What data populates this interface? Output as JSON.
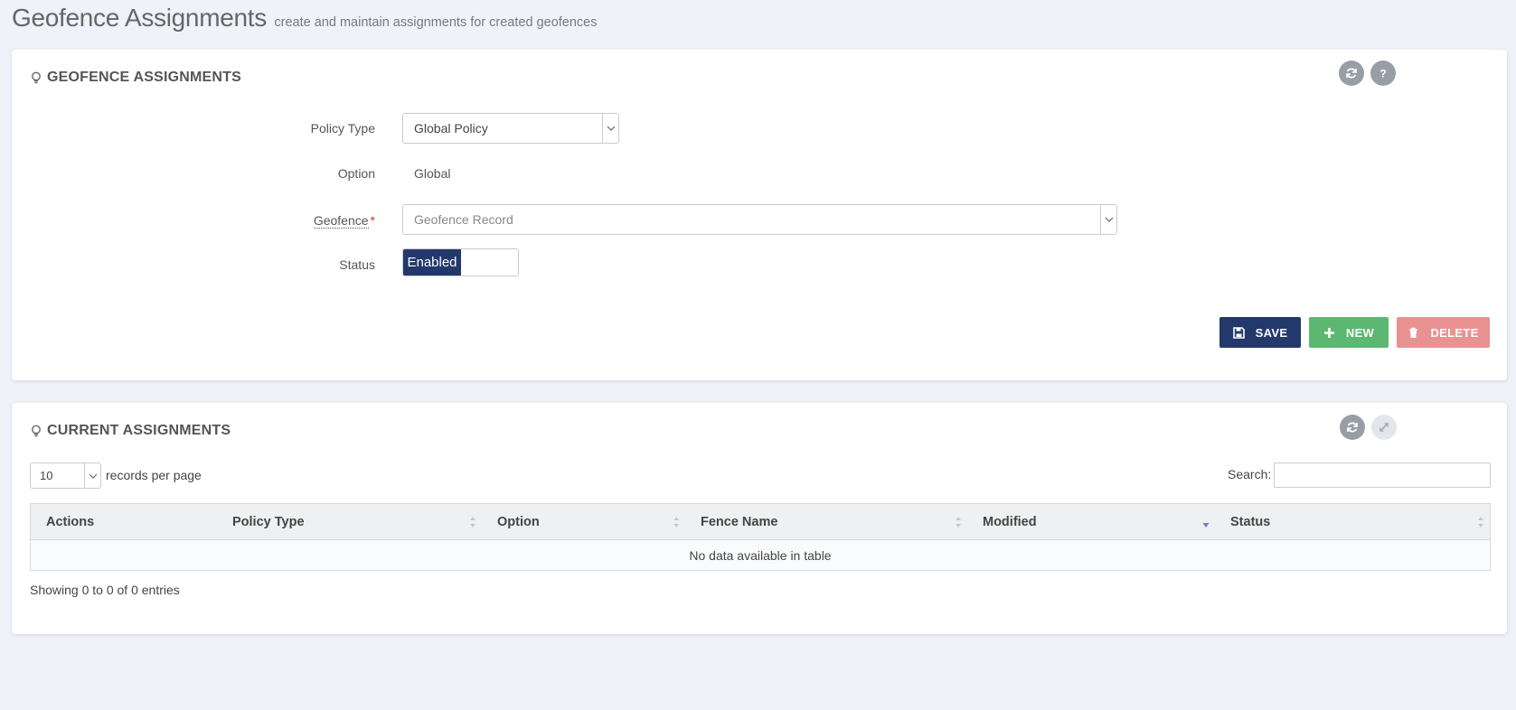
{
  "header": {
    "title": "Geofence Assignments",
    "subtitle": "create and maintain assignments for created geofences"
  },
  "assignment_panel": {
    "title": "GEOFENCE ASSIGNMENTS",
    "title_icon": "lightbulb-icon",
    "tools": [
      "refresh-icon",
      "help-icon"
    ],
    "form": {
      "policy_type_label": "Policy Type",
      "policy_type_value": "Global Policy",
      "option_label": "Option",
      "option_value": "Global",
      "geofence_label": "Geofence",
      "geofence_required_mark": "*",
      "geofence_placeholder": "Geofence Record",
      "status_label": "Status",
      "status_value": "Enabled"
    },
    "buttons": {
      "save": "SAVE",
      "new": "NEW",
      "delete": "DELETE"
    }
  },
  "current_panel": {
    "title": "CURRENT ASSIGNMENTS",
    "title_icon": "lightbulb-icon",
    "tools": [
      "refresh-icon",
      "expand-icon"
    ],
    "page_length": "10",
    "page_length_label": "records per page",
    "search_label": "Search:",
    "columns": [
      "Actions",
      "Policy Type",
      "Option",
      "Fence Name",
      "Modified",
      "Status"
    ],
    "sorted_column": "Modified",
    "empty_message": "No data available in table",
    "info": "Showing 0 to 0 of 0 entries"
  },
  "colors": {
    "primary": "#23396b",
    "success": "#5cb870",
    "danger": "#e89292",
    "background": "#eff2f8"
  }
}
